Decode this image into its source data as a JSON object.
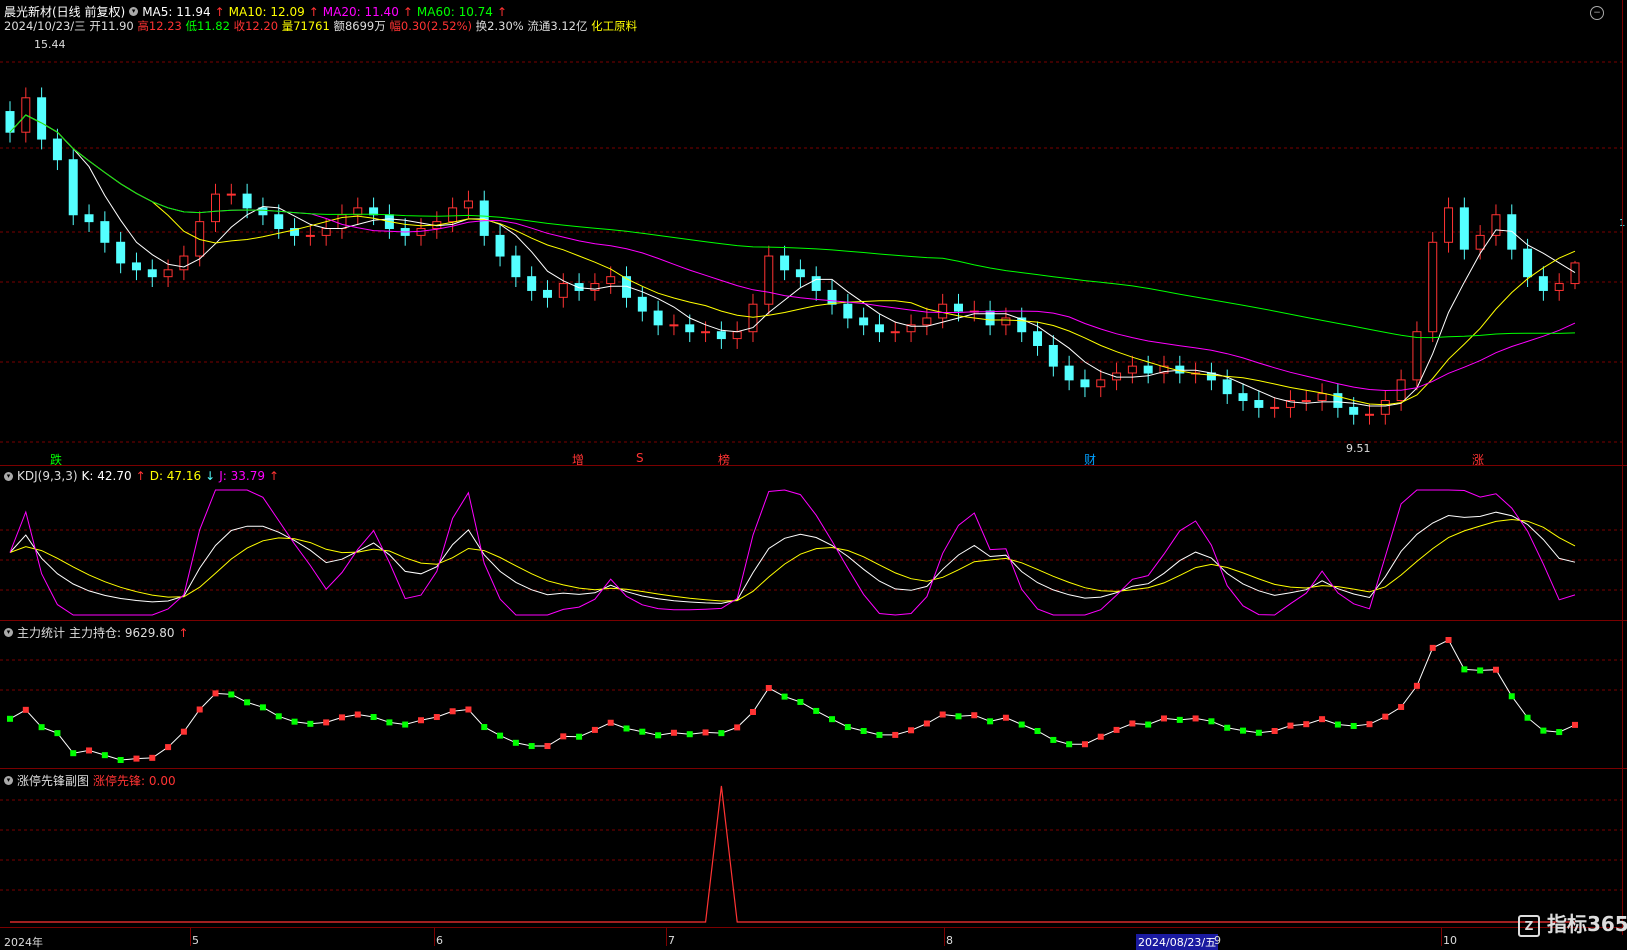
{
  "header": {
    "title": "晨光新材(日线 前复权)",
    "ma": [
      {
        "label": "MA5: 11.94",
        "color": "#ffffff"
      },
      {
        "label": "MA10: 12.09",
        "color": "#ffff00"
      },
      {
        "label": "MA20: 11.40",
        "color": "#ff00ff"
      },
      {
        "label": "MA60: 10.74",
        "color": "#00ff00"
      }
    ],
    "info": {
      "date": "2024/10/23/三",
      "open_label": "开",
      "open": "11.90",
      "high_label": "高",
      "high": "12.23",
      "low_label": "低",
      "low": "11.82",
      "close_label": "收",
      "close": "12.20",
      "vol_label": "量",
      "vol": "71761",
      "amount": "额8699万",
      "change": "幅0.30(2.52%)",
      "turnover": "换2.30%",
      "float": "流通3.12亿",
      "industry": "化工原料"
    }
  },
  "price_labels": {
    "max": "15.44",
    "min": "9.51"
  },
  "event_markers": [
    {
      "text": "跌",
      "color": "#00ff00"
    },
    {
      "text": "增",
      "color": "#ff3333"
    },
    {
      "text": "S",
      "color": "#ff3333"
    },
    {
      "text": "榜",
      "color": "#ff3333"
    },
    {
      "text": "财",
      "color": "#00a0ff"
    },
    {
      "text": "涨",
      "color": "#ff3333"
    }
  ],
  "kdj": {
    "title": "KDJ(9,3,3)",
    "k": "K: 42.70",
    "d": "D: 47.16",
    "j": "J: 33.79"
  },
  "main_force": {
    "title": "主力统计",
    "label": "主力持仓: 9629.80"
  },
  "limit_pioneer": {
    "title": "涨停先锋副图",
    "label": "涨停先锋: 0.00"
  },
  "xaxis": {
    "ticks": [
      "2024年",
      "5",
      "6",
      "7",
      "8",
      "9",
      "10"
    ],
    "cursor_date": "2024/08/23/五"
  },
  "right_marker": "1",
  "watermark": "指标365",
  "colors": {
    "up": "#ff3333",
    "down": "#54ffff",
    "ma5": "#ffffff",
    "ma10": "#ffff00",
    "ma20": "#ff00ff",
    "ma60": "#00ff00",
    "kdj_k": "#ffffff",
    "kdj_d": "#ffff00",
    "kdj_j": "#ff00ff",
    "grid": "#7a0000"
  },
  "chart_data": [
    {
      "type": "candlestick",
      "title": "晨光新材(日线 前复权)",
      "price_range": [
        9.51,
        15.44
      ],
      "x_range": [
        "2024-04",
        "2024-10-23"
      ],
      "last_bar": {
        "open": 11.9,
        "high": 12.23,
        "low": 11.82,
        "close": 12.2
      },
      "ma_latest": {
        "MA5": 11.94,
        "MA10": 12.09,
        "MA20": 11.4,
        "MA60": 10.74
      },
      "close_approx": [
        14.1,
        14.6,
        14.0,
        13.7,
        12.9,
        12.8,
        12.5,
        12.2,
        12.1,
        12.0,
        12.1,
        12.3,
        12.8,
        13.2,
        13.2,
        13.0,
        12.9,
        12.7,
        12.6,
        12.6,
        12.7,
        12.9,
        13.0,
        12.9,
        12.7,
        12.6,
        12.7,
        12.8,
        13.0,
        13.1,
        12.6,
        12.3,
        12.0,
        11.8,
        11.7,
        11.9,
        11.8,
        11.9,
        12.0,
        11.7,
        11.5,
        11.3,
        11.3,
        11.2,
        11.2,
        11.1,
        11.2,
        11.6,
        12.3,
        12.1,
        12.0,
        11.8,
        11.6,
        11.4,
        11.3,
        11.2,
        11.2,
        11.3,
        11.4,
        11.6,
        11.5,
        11.5,
        11.3,
        11.4,
        11.2,
        11.0,
        10.7,
        10.5,
        10.4,
        10.5,
        10.6,
        10.7,
        10.6,
        10.7,
        10.6,
        10.6,
        10.5,
        10.3,
        10.2,
        10.1,
        10.1,
        10.2,
        10.2,
        10.3,
        10.1,
        10.0,
        10.0,
        10.2,
        10.5,
        11.2,
        12.5,
        13.0,
        12.4,
        12.6,
        12.9,
        12.4,
        12.0,
        11.8,
        11.9,
        12.2
      ],
      "ylim": [
        9.51,
        15.44
      ]
    },
    {
      "type": "line",
      "title": "KDJ(9,3,3)",
      "series": [
        {
          "name": "K",
          "latest": 42.7
        },
        {
          "name": "D",
          "latest": 47.16
        },
        {
          "name": "J",
          "latest": 33.79
        }
      ]
    },
    {
      "type": "line",
      "title": "主力统计",
      "series": [
        {
          "name": "主力持仓",
          "latest": 9629.8
        }
      ]
    },
    {
      "type": "line",
      "title": "涨停先锋副图",
      "series": [
        {
          "name": "涨停先锋",
          "latest": 0.0
        }
      ]
    }
  ]
}
